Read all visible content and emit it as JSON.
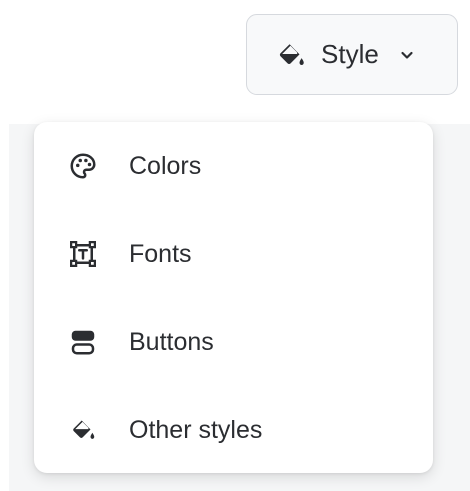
{
  "style_button": {
    "label": "Style",
    "icon": "paint-bucket-icon",
    "chevron": "chevron-down-icon"
  },
  "menu": {
    "items": [
      {
        "label": "Colors",
        "icon": "palette-icon"
      },
      {
        "label": "Fonts",
        "icon": "text-frame-icon"
      },
      {
        "label": "Buttons",
        "icon": "buttons-icon"
      },
      {
        "label": "Other styles",
        "icon": "paint-bucket-icon"
      }
    ]
  },
  "colors": {
    "text": "#2b2d31",
    "border": "#d6d9de",
    "button_bg": "#f8f9fa",
    "backdrop": "#f5f6f7"
  }
}
